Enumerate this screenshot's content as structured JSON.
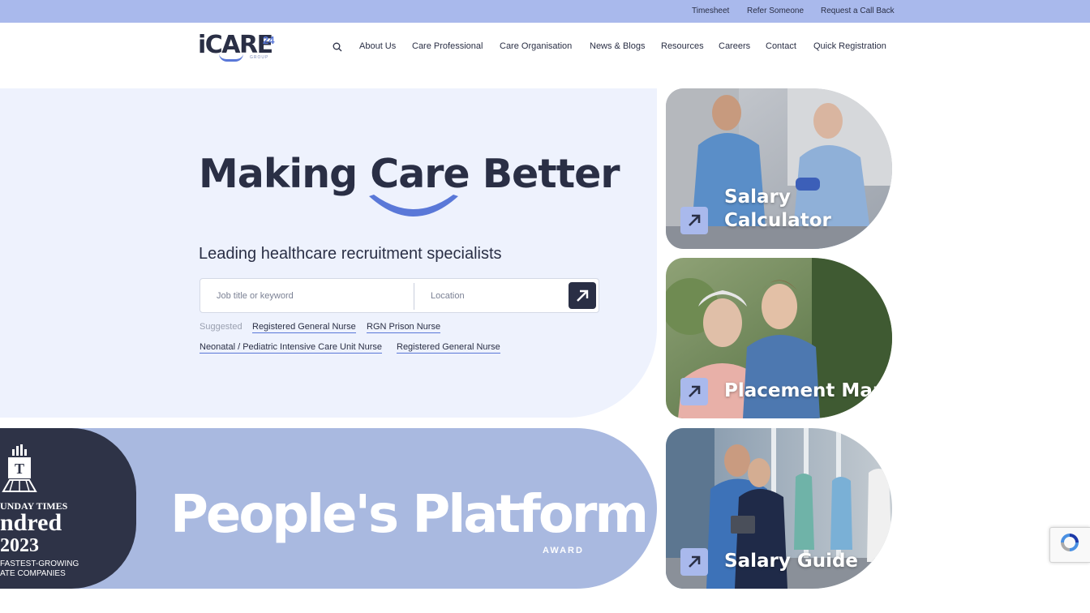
{
  "topbar": {
    "links": [
      "Timesheet",
      "Refer Someone",
      "Request a Call Back"
    ]
  },
  "logo": {
    "word": "iCARE",
    "number": "24",
    "group": "GROUP"
  },
  "nav": {
    "search_icon": "search-icon",
    "items": [
      "About Us",
      "Care Professional",
      "Care Organisation",
      "News & Blogs",
      "Resources",
      "Careers",
      "Contact",
      "Quick Registration"
    ]
  },
  "hero": {
    "title": "Making Care Better",
    "subtitle": "Leading healthcare recruitment specialists",
    "search": {
      "keyword_placeholder": "Job title or keyword",
      "location_placeholder": "Location",
      "submit_icon": "arrow-up-right-icon"
    },
    "suggested_label": "Suggested",
    "suggestions": [
      "Registered General Nurse",
      "RGN Prison Nurse",
      "Neonatal / Pediatric Intensive Care Unit Nurse",
      "Registered General Nurse"
    ]
  },
  "award": {
    "sunday_times": "UNDAY TIMES",
    "hundred": "ndred",
    "year": "2023",
    "line1": "FASTEST-GROWING",
    "line2": "ATE COMPANIES",
    "headline": "People's Platform",
    "small": "AWARD"
  },
  "cards": [
    {
      "title_line1": "Salary",
      "title_line2": "Calculator"
    },
    {
      "title_line1": "Placement Map",
      "title_line2": ""
    },
    {
      "title_line1": "Salary Guide",
      "title_line2": ""
    }
  ],
  "colors": {
    "accent": "#5a78d8",
    "accent_light": "#a9b9ec",
    "dark": "#2a2f45",
    "hero_bg": "#eef2fd"
  }
}
